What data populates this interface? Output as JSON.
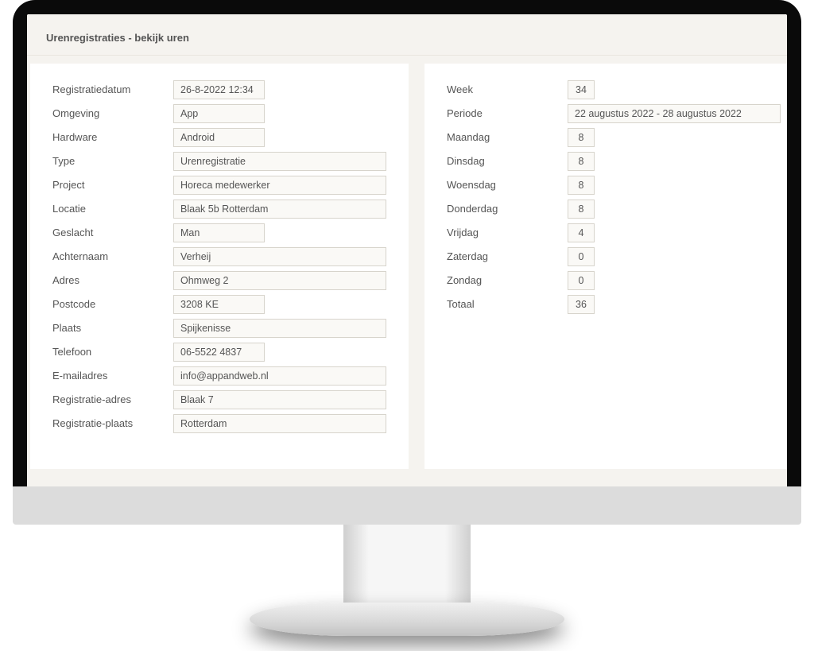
{
  "pageTitle": "Urenregistraties - bekijk uren",
  "left": {
    "labels": {
      "registratiedatum": "Registratiedatum",
      "omgeving": "Omgeving",
      "hardware": "Hardware",
      "type": "Type",
      "project": "Project",
      "locatie": "Locatie",
      "geslacht": "Geslacht",
      "achternaam": "Achternaam",
      "adres": "Adres",
      "postcode": "Postcode",
      "plaats": "Plaats",
      "telefoon": "Telefoon",
      "email": "E-mailadres",
      "regAdres": "Registratie-adres",
      "regPlaats": "Registratie-plaats"
    },
    "values": {
      "registratiedatum": "26-8-2022 12:34",
      "omgeving": "App",
      "hardware": "Android",
      "type": "Urenregistratie",
      "project": "Horeca medewerker",
      "locatie": "Blaak 5b Rotterdam",
      "geslacht": "Man",
      "achternaam": "Verheij",
      "adres": "Ohmweg 2",
      "postcode": "3208 KE",
      "plaats": "Spijkenisse",
      "telefoon": "06-5522 4837",
      "email": "info@appandweb.nl",
      "regAdres": "Blaak 7",
      "regPlaats": "Rotterdam"
    }
  },
  "right": {
    "labels": {
      "week": "Week",
      "periode": "Periode",
      "maandag": "Maandag",
      "dinsdag": "Dinsdag",
      "woensdag": "Woensdag",
      "donderdag": "Donderdag",
      "vrijdag": "Vrijdag",
      "zaterdag": "Zaterdag",
      "zondag": "Zondag",
      "totaal": "Totaal"
    },
    "values": {
      "week": "34",
      "periode": "22 augustus 2022 - 28 augustus 2022",
      "maandag": "8",
      "dinsdag": "8",
      "woensdag": "8",
      "donderdag": "8",
      "vrijdag": "4",
      "zaterdag": "0",
      "zondag": "0",
      "totaal": "36"
    }
  }
}
